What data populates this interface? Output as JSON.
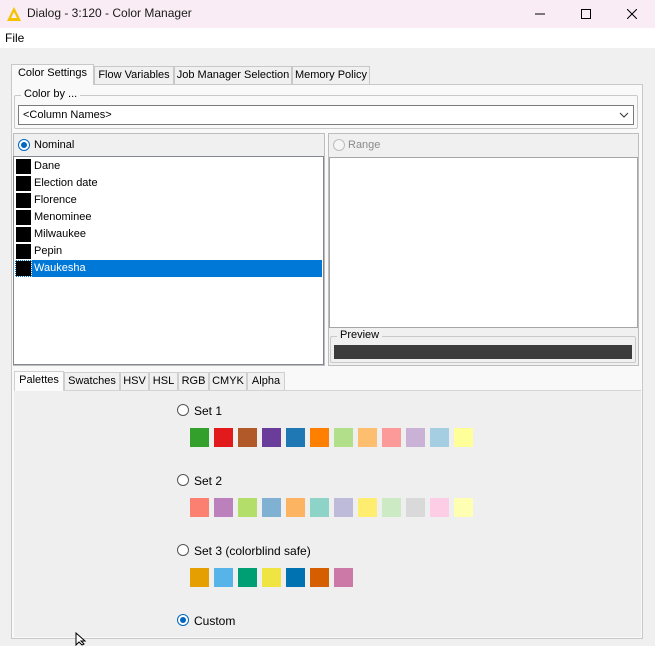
{
  "window": {
    "title": "Dialog - 3:120 - Color Manager",
    "controls": [
      "minimize-icon",
      "maximize-icon",
      "close-icon"
    ]
  },
  "menu": {
    "file": "File"
  },
  "tabs": [
    {
      "label": "Color Settings"
    },
    {
      "label": "Flow Variables"
    },
    {
      "label": "Job Manager Selection"
    },
    {
      "label": "Memory Policy"
    }
  ],
  "color_by": {
    "legend": "Color by ...",
    "selected": "<Column Names>"
  },
  "nominal": {
    "label": "Nominal",
    "items": [
      {
        "label": "Dane",
        "color": "#000000"
      },
      {
        "label": "Election date",
        "color": "#000000"
      },
      {
        "label": "Florence",
        "color": "#000000"
      },
      {
        "label": "Menominee",
        "color": "#000000"
      },
      {
        "label": "Milwaukee",
        "color": "#000000"
      },
      {
        "label": "Pepin",
        "color": "#000000"
      },
      {
        "label": "Waukesha",
        "color": "#000000"
      }
    ],
    "selected_index": 6
  },
  "range": {
    "label": "Range"
  },
  "preview": {
    "legend": "Preview",
    "color": "#3c3c3c"
  },
  "chooser_tabs": [
    {
      "label": "Palettes"
    },
    {
      "label": "Swatches"
    },
    {
      "label": "HSV"
    },
    {
      "label": "HSL"
    },
    {
      "label": "RGB"
    },
    {
      "label": "CMYK"
    },
    {
      "label": "Alpha"
    }
  ],
  "palettes": [
    {
      "label": "Set 1",
      "colors": [
        "#33a02c",
        "#e31a1c",
        "#b15928",
        "#6a3d9a",
        "#1f78b4",
        "#ff7f00",
        "#b2df8a",
        "#fdbf6f",
        "#fb9a99",
        "#cab2d6",
        "#a6cee3",
        "#ffff99"
      ]
    },
    {
      "label": "Set 2",
      "colors": [
        "#fb8072",
        "#bc80bd",
        "#b3de69",
        "#80b1d3",
        "#fdb462",
        "#8dd3c7",
        "#bebada",
        "#ffed6f",
        "#ccebc5",
        "#d9d9d9",
        "#fccde5",
        "#ffffb3"
      ]
    },
    {
      "label": "Set 3 (colorblind safe)",
      "colors": [
        "#e69f00",
        "#56b4e9",
        "#009e73",
        "#f0e442",
        "#0072b2",
        "#d55e00",
        "#cc79a7"
      ]
    },
    {
      "label": "Custom",
      "colors": []
    }
  ],
  "accent": "#0078d7"
}
